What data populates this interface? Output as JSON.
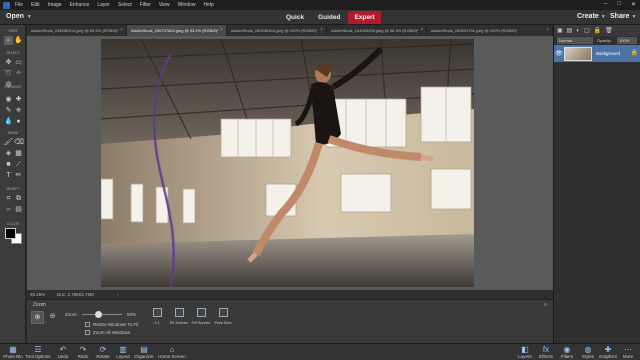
{
  "menubar": {
    "items": [
      "File",
      "Edit",
      "Image",
      "Enhance",
      "Layer",
      "Select",
      "Filter",
      "View",
      "Window",
      "Help"
    ]
  },
  "topbar": {
    "open_label": "Open",
    "modes": [
      "Quick",
      "Guided",
      "Expert"
    ],
    "active_mode": "Expert",
    "create_label": "Create",
    "share_label": "Share"
  },
  "doc_tabs": [
    {
      "label": "AdobeStock_234556104.jpeg @ 80.2% (RGB/8)*",
      "active": false
    },
    {
      "label": "AdobeStock_296707802.jpeg @ 93.2% (RGB/8)*",
      "active": true
    },
    {
      "label": "AdobeStock_280248163.jpeg @ 100% (RGB/8)*",
      "active": false
    },
    {
      "label": "AdobeStock_164495296.jpeg @ 98.3% (RGB/8)*",
      "active": false
    },
    {
      "label": "AdobeStock_230524791.jpeg @ 100% (RGB/8)*",
      "active": false
    }
  ],
  "toolbar": {
    "sections": [
      "VIEW",
      "SELECT",
      "ENHANCE",
      "DRAW",
      "MODIFY",
      "COLOR"
    ]
  },
  "status": {
    "zoom": "93.25%",
    "doc": "Doc: 2.75M/2.75M"
  },
  "tool_options": {
    "title": "Zoom",
    "zoom_label": "Zoom:",
    "zoom_value": "93%",
    "resize_windows": "Resize Windows To Fit",
    "zoom_all": "Zoom All Windows",
    "view_buttons": [
      "1:1",
      "Fit Screen",
      "Fill Screen",
      "Print Size"
    ]
  },
  "layers": {
    "blend_mode": "Normal",
    "opacity_label": "Opacity:",
    "opacity_value": "100%",
    "layer_name": "Background"
  },
  "bottombar": {
    "left": [
      "Photo Bin",
      "Tool Options",
      "Undo",
      "Redo",
      "Rotate",
      "Layout",
      "Organizer",
      "Home Screen"
    ],
    "right": [
      "Layers",
      "Effects",
      "Filters",
      "Styles",
      "Graphics",
      "More"
    ]
  }
}
